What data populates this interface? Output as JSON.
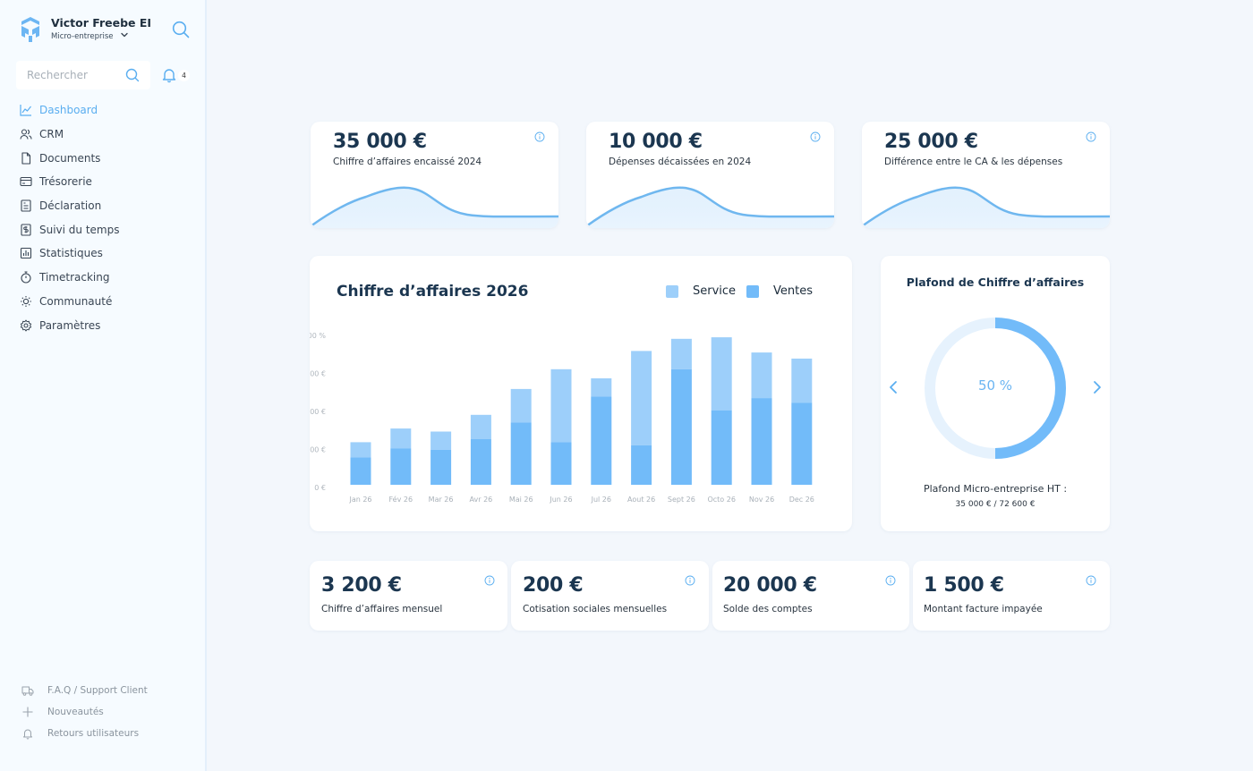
{
  "sidebar": {
    "company_name": "Victor Freebe EI",
    "company_type": "Micro-entreprise",
    "search_placeholder": "Rechercher",
    "notification_count": "4",
    "nav": [
      {
        "label": "Dashboard",
        "icon": "chart-line-icon",
        "active": true
      },
      {
        "label": "CRM",
        "icon": "users-icon"
      },
      {
        "label": "Documents",
        "icon": "file-icon"
      },
      {
        "label": "Trésorerie",
        "icon": "credit-card-icon"
      },
      {
        "label": "Déclaration",
        "icon": "form-icon"
      },
      {
        "label": "Suivi du temps",
        "icon": "time-invoice-icon"
      },
      {
        "label": "Statistiques",
        "icon": "bar-chart-icon"
      },
      {
        "label": "Timetracking",
        "icon": "stopwatch-icon"
      },
      {
        "label": "Communauté",
        "icon": "sun-icon"
      },
      {
        "label": "Paramètres",
        "icon": "gear-icon"
      }
    ],
    "footer": [
      {
        "label": "F.A.Q / Support Client",
        "icon": "truck-icon"
      },
      {
        "label": "Nouveautés",
        "icon": "plus-icon"
      },
      {
        "label": "Retours utilisateurs",
        "icon": "bell-icon"
      }
    ]
  },
  "kpis_top": [
    {
      "value": "35 000 €",
      "label": "Chiffre d’affaires encaissé 2024"
    },
    {
      "value": "10 000 €",
      "label": "Dépenses décaissées en 2024"
    },
    {
      "value": "25 000 €",
      "label": "Différence entre le CA & les dépenses"
    }
  ],
  "revenue_chart": {
    "title": "Chiffre d’affaires 2026",
    "legend": [
      "Service",
      "Ventes"
    ]
  },
  "chart_data": {
    "type": "bar",
    "stacked": true,
    "title": "Chiffre d’affaires 2026",
    "categories": [
      "Jan 26",
      "Fév 26",
      "Mar 26",
      "Avr 26",
      "Mai 26",
      "Jun 26",
      "Jul 26",
      "Aout 26",
      "Sept 26",
      "Octo 26",
      "Nov 26",
      "Dec 26"
    ],
    "series": [
      {
        "name": "Ventes",
        "values": [
          180,
          240,
          230,
          300,
          410,
          280,
          580,
          260,
          760,
          490,
          570,
          540
        ]
      },
      {
        "name": "Service",
        "values": [
          100,
          130,
          120,
          160,
          220,
          480,
          120,
          620,
          200,
          480,
          300,
          290
        ]
      }
    ],
    "y_ticks": [
      "0 €",
      "00 €",
      "00 €",
      "00 €",
      "00 %"
    ],
    "ylim": [
      0,
      1000
    ],
    "grid": false,
    "legend_position": "top-right",
    "colors": {
      "Ventes": "#72bbf9",
      "Service": "#9dcffa"
    }
  },
  "plafond": {
    "title": "Plafond de Chiffre d’affaires",
    "percent_label": "50 %",
    "percent": 50,
    "subtitle": "Plafond Micro-entreprise HT :",
    "detail": "35 000 € / 72 600 €"
  },
  "kpis_bottom": [
    {
      "value": "3 200 €",
      "label": "Chiffre d’affaires mensuel"
    },
    {
      "value": "200 €",
      "label": "Cotisation sociales mensuelles"
    },
    {
      "value": "20 000 €",
      "label": "Solde des comptes"
    },
    {
      "value": "1 500 €",
      "label": "Montant facture impayée"
    }
  ],
  "colors": {
    "accent": "#5aaef0",
    "dark_text": "#1b3650",
    "background": "#f3f7fc"
  }
}
